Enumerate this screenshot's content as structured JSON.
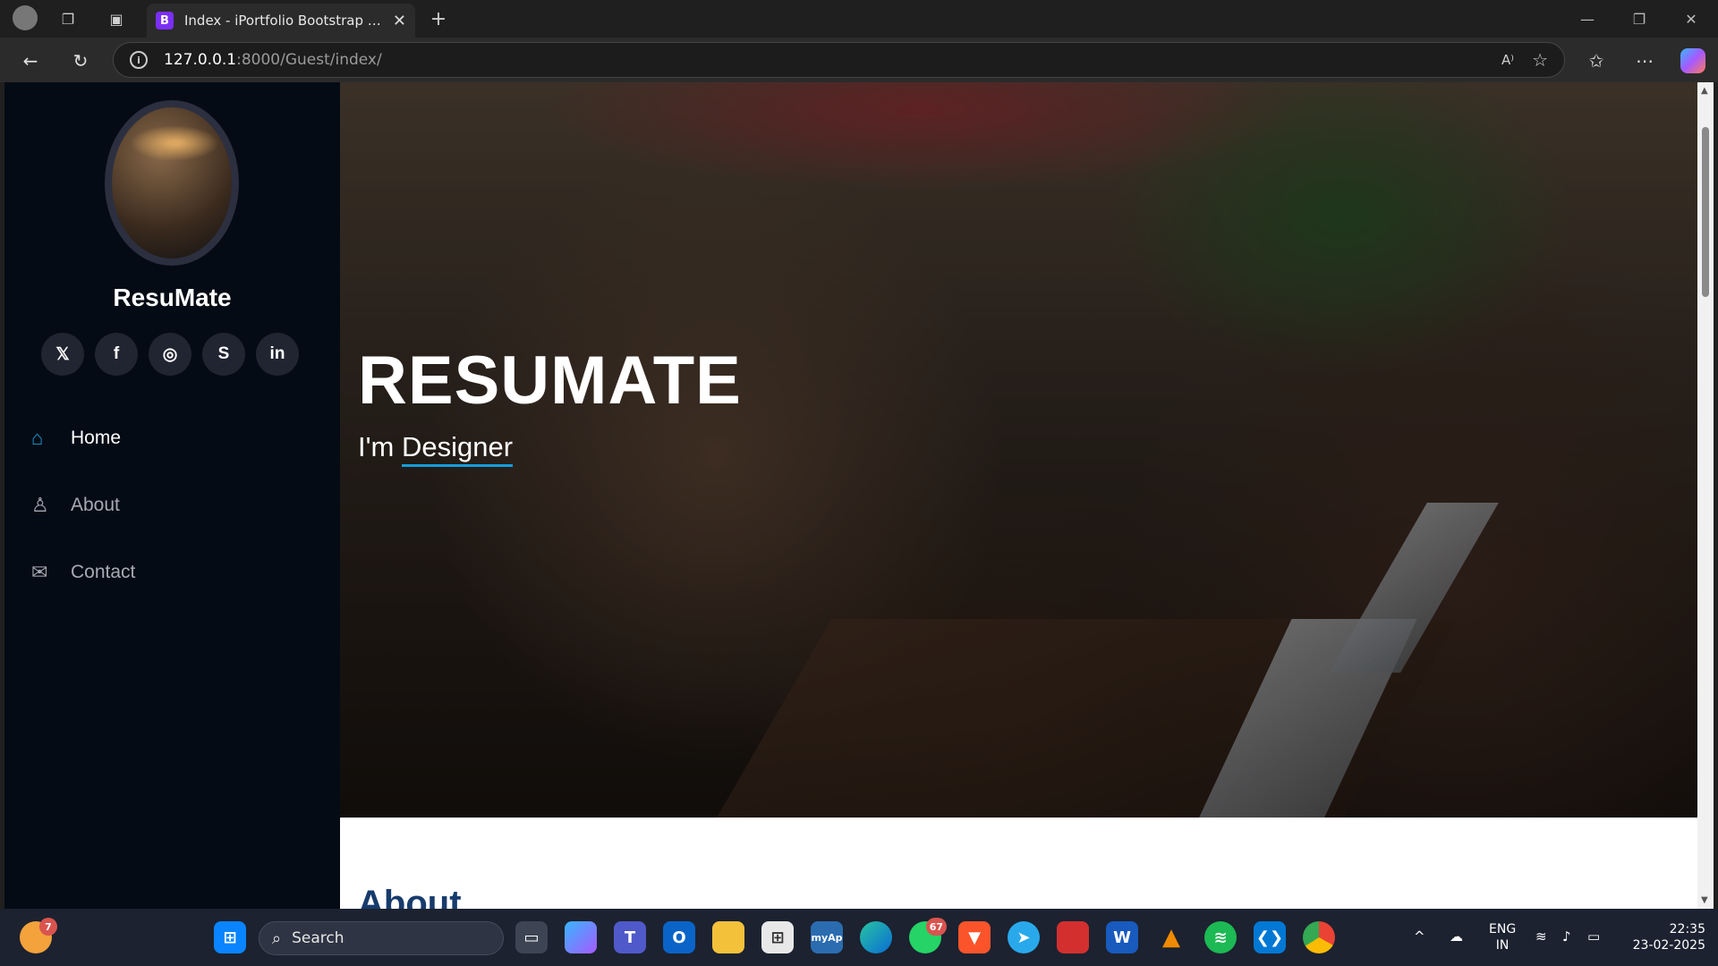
{
  "browser": {
    "tab_title": "Index - iPortfolio Bootstrap Template",
    "tab_favicon": "B",
    "url_host": "127.0.0.1",
    "url_path": ":8000/Guest/index/"
  },
  "sidebar": {
    "brand": "ResuMate",
    "socials": [
      {
        "icon": "x-twitter-icon",
        "glyph": "𝕏"
      },
      {
        "icon": "facebook-icon",
        "glyph": "f"
      },
      {
        "icon": "instagram-icon",
        "glyph": "◎"
      },
      {
        "icon": "skype-icon",
        "glyph": "S"
      },
      {
        "icon": "linkedin-icon",
        "glyph": "in"
      }
    ],
    "menu": [
      {
        "label": "Home",
        "icon": "house-icon",
        "active": true
      },
      {
        "label": "About",
        "icon": "person-icon",
        "active": false
      },
      {
        "label": "Contact",
        "icon": "envelope-icon",
        "active": false
      }
    ]
  },
  "hero": {
    "title": "RESUMATE",
    "prefix": "I'm ",
    "typed": "Designer"
  },
  "section": {
    "about_heading": "About"
  },
  "taskbar": {
    "search_placeholder": "Search",
    "whatsapp_badge": "67",
    "weather_badge": "7",
    "lang_line1": "ENG",
    "lang_line2": "IN",
    "time": "22:35",
    "date": "23-02-2025"
  },
  "colors": {
    "accent": "#149ddd",
    "sidebar_bg": "#040b14",
    "heading": "#173b6c"
  }
}
